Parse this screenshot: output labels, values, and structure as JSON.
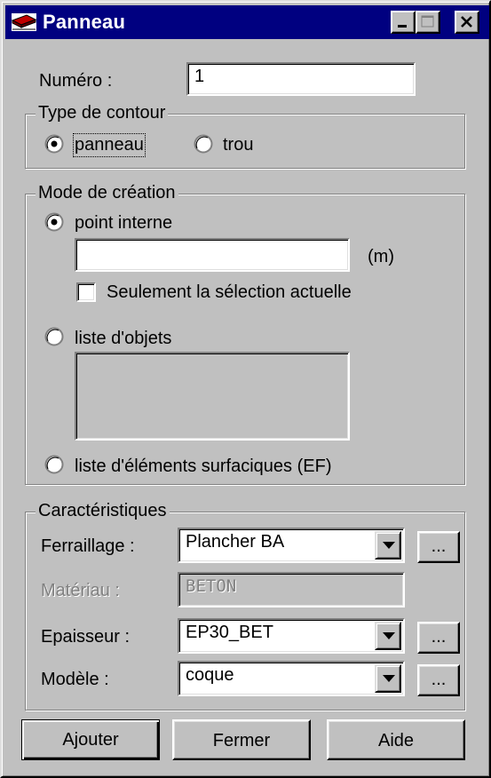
{
  "window": {
    "title": "Panneau",
    "minimize_label": "_",
    "maximize_label": "□",
    "close_label": "×"
  },
  "numero": {
    "label": "Numéro :",
    "value": "1"
  },
  "type_contour": {
    "title": "Type de contour",
    "option_panneau": "panneau",
    "option_trou": "trou",
    "selected": "panneau"
  },
  "mode_creation": {
    "title": "Mode de création",
    "option_point_interne": "point interne",
    "point_interne_value": "",
    "unit": "(m)",
    "selection_checkbox_label": "Seulement la sélection actuelle",
    "selection_checked": false,
    "option_liste_objets": "liste d'objets",
    "liste_objets_value": "",
    "option_liste_elements": "liste d'éléments surfaciques (EF)",
    "selected": "point interne"
  },
  "caracteristiques": {
    "title": "Caractéristiques",
    "ferraillage_label": "Ferraillage :",
    "ferraillage_value": "Plancher BA",
    "materiau_label": "Matériau :",
    "materiau_value": "BETON",
    "epaisseur_label": "Epaisseur :",
    "epaisseur_value": "EP30_BET",
    "modele_label": "Modèle :",
    "modele_value": "coque",
    "browse_label": "..."
  },
  "buttons": {
    "ajouter": "Ajouter",
    "fermer": "Fermer",
    "aide": "Aide"
  },
  "colors": {
    "titlebar": "#000080",
    "face": "#c0c0c0",
    "field": "#ffffff"
  },
  "icons": {
    "window": "panel-slab-icon",
    "dropdown": "chevron-down-icon"
  }
}
